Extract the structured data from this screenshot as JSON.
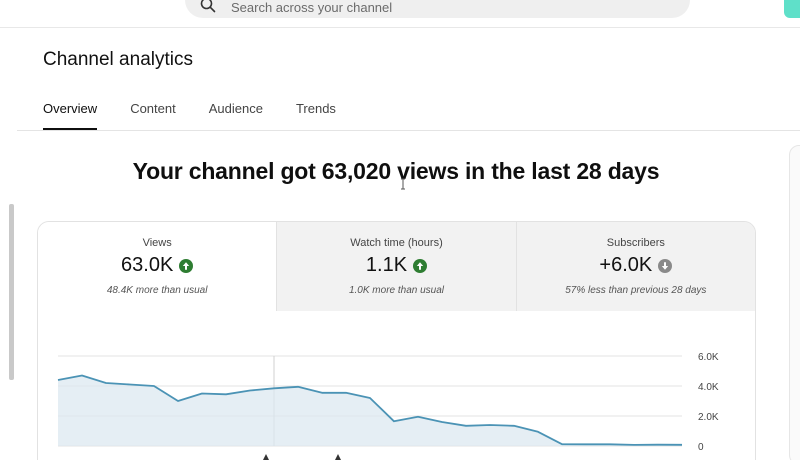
{
  "search": {
    "placeholder": "Search across your channel"
  },
  "page": {
    "title": "Channel analytics"
  },
  "tabs": [
    {
      "label": "Overview",
      "active": true
    },
    {
      "label": "Content",
      "active": false
    },
    {
      "label": "Audience",
      "active": false
    },
    {
      "label": "Trends",
      "active": false
    }
  ],
  "headline": "Your channel got 63,020 views in the last 28 days",
  "metrics": [
    {
      "label": "Views",
      "value": "63.0K",
      "trend": "up",
      "note": "48.4K more than usual"
    },
    {
      "label": "Watch time (hours)",
      "value": "1.1K",
      "trend": "up",
      "note": "1.0K more than usual"
    },
    {
      "label": "Subscribers",
      "value": "+6.0K",
      "trend": "down",
      "note": "57% less than previous 28 days"
    }
  ],
  "colors": {
    "up": "#2e7d32",
    "down": "#8a8a8a",
    "line": "#4b93b5",
    "area": "#dce8f0"
  },
  "chart_data": {
    "type": "area",
    "series": [
      {
        "values": [
          4400,
          4700,
          4200,
          4100,
          4000,
          3000,
          3500,
          3450,
          3700,
          3850,
          3950,
          3550,
          3550,
          3200,
          1650,
          1950,
          1600,
          1350,
          1400,
          1350,
          950,
          120,
          110,
          110,
          70,
          90,
          80
        ]
      }
    ],
    "yticks": [
      "6.0K",
      "4.0K",
      "2.0K",
      "0"
    ],
    "ylim": [
      0,
      6000
    ],
    "grid": true
  }
}
